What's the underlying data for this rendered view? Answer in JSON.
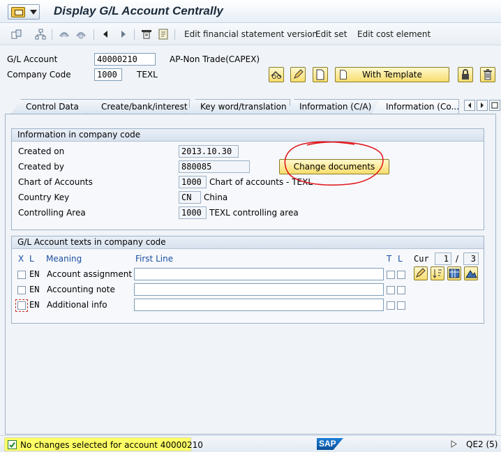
{
  "window": {
    "title": "Display G/L Account Centrally",
    "toolbar_links": [
      "Edit financial statement version",
      "Edit set",
      "Edit cost element"
    ]
  },
  "header": {
    "gl_account_label": "G/L Account",
    "gl_account_value": "40000210",
    "gl_account_desc": "AP-Non Trade(CAPEX)",
    "company_code_label": "Company Code",
    "company_code_value": "1000",
    "company_code_desc": "TEXL",
    "with_template_label": "With Template"
  },
  "tabs": [
    {
      "label": "Control Data"
    },
    {
      "label": "Create/bank/interest"
    },
    {
      "label": "Key word/translation"
    },
    {
      "label": "Information (C/A)"
    },
    {
      "label": "Information (Co..."
    }
  ],
  "info_group": {
    "title": "Information in company code",
    "created_on_label": "Created on",
    "created_on_value": "2013.10.30",
    "created_by_label": "Created by",
    "created_by_value": "880085",
    "change_documents_label": "Change documents",
    "chart_label": "Chart of Accounts",
    "chart_value": "1000",
    "chart_desc": "Chart of accounts - TEXL",
    "country_label": "Country Key",
    "country_value": "CN",
    "country_desc": "China",
    "ca_label": "Controlling Area",
    "ca_value": "1000",
    "ca_desc": "TEXL controlling area"
  },
  "texts_group": {
    "title": "G/L Account texts in company code",
    "col_x": "X",
    "col_l": "L",
    "col_meaning": "Meaning",
    "col_first_line": "First Line",
    "col_t": "T",
    "col_l2": "L",
    "cur_label": "Cur",
    "cur_value": "1",
    "slash": "/",
    "total_value": "3",
    "rows": [
      {
        "lang": "EN",
        "meaning": "Account assignment ...",
        "first_line": ""
      },
      {
        "lang": "EN",
        "meaning": "Accounting note",
        "first_line": ""
      },
      {
        "lang": "EN",
        "meaning": "Additional info",
        "first_line": ""
      }
    ]
  },
  "status": {
    "message": "No changes selected for account 40000210",
    "system": "QE2 (5)",
    "logo": "SAP"
  },
  "colors": {
    "annotation": "#e0191f",
    "status_highlight": "#ffff66",
    "button_yellow": "#f7dd6d"
  }
}
